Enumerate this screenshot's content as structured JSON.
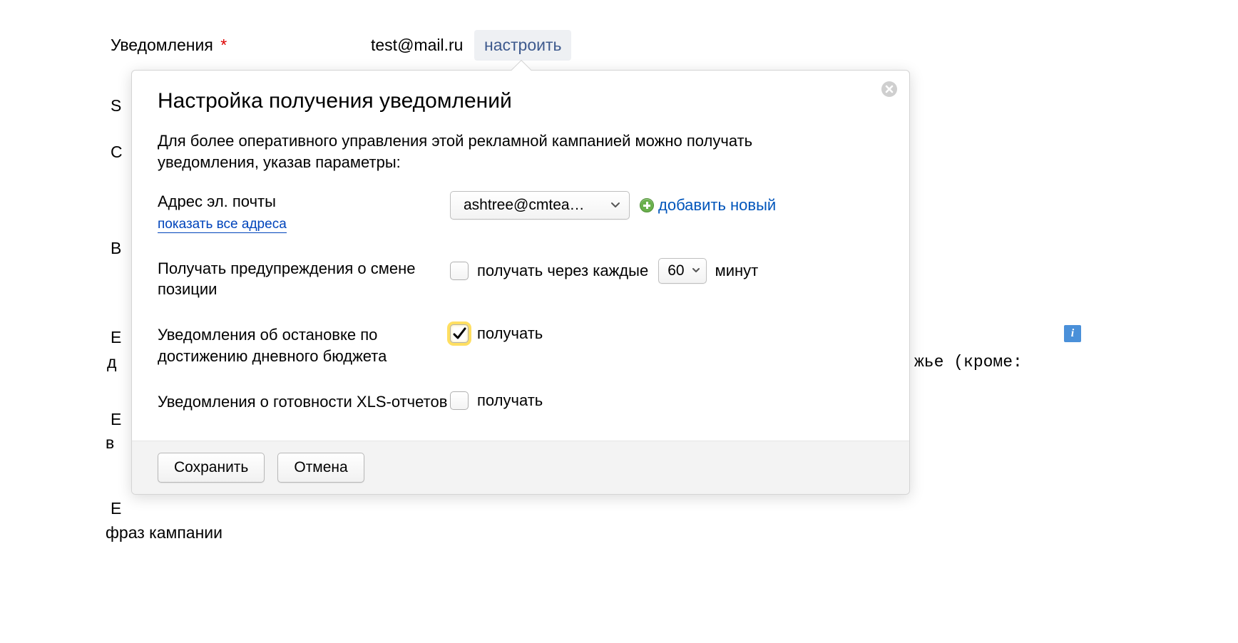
{
  "background": {
    "notifications_label": "Уведомления",
    "required_mark": "*",
    "email": "test@mail.ru",
    "configure": "настроить",
    "suffix_text": "жье (кроме:",
    "phrase_campaign": "фраз кампании",
    "letters": {
      "s": "S",
      "c": "С",
      "v": "В",
      "e1": "Е",
      "d": "д",
      "e2": "Е",
      "vo": "в",
      "e3": "Е"
    }
  },
  "modal": {
    "title": "Настройка получения уведомлений",
    "intro": "Для более оперативного управления этой рекламной кампанией можно получать уведомления, указав параметры:",
    "email_label": "Адрес эл. почты",
    "show_all": "показать все адреса",
    "email_selected": "ashtree@cmtea…",
    "add_new": "добавить новый",
    "position_label": "Получать предупреждения о смене позиции",
    "position_cb_label": "получать через каждые",
    "interval_value": "60",
    "interval_unit": "минут",
    "budget_label": "Уведомления об остановке по достижению дневного бюджета",
    "budget_cb_label": "получать",
    "xls_label": "Уведомления о готовности XLS-отчетов",
    "xls_cb_label": "получать",
    "save": "Сохранить",
    "cancel": "Отмена"
  }
}
